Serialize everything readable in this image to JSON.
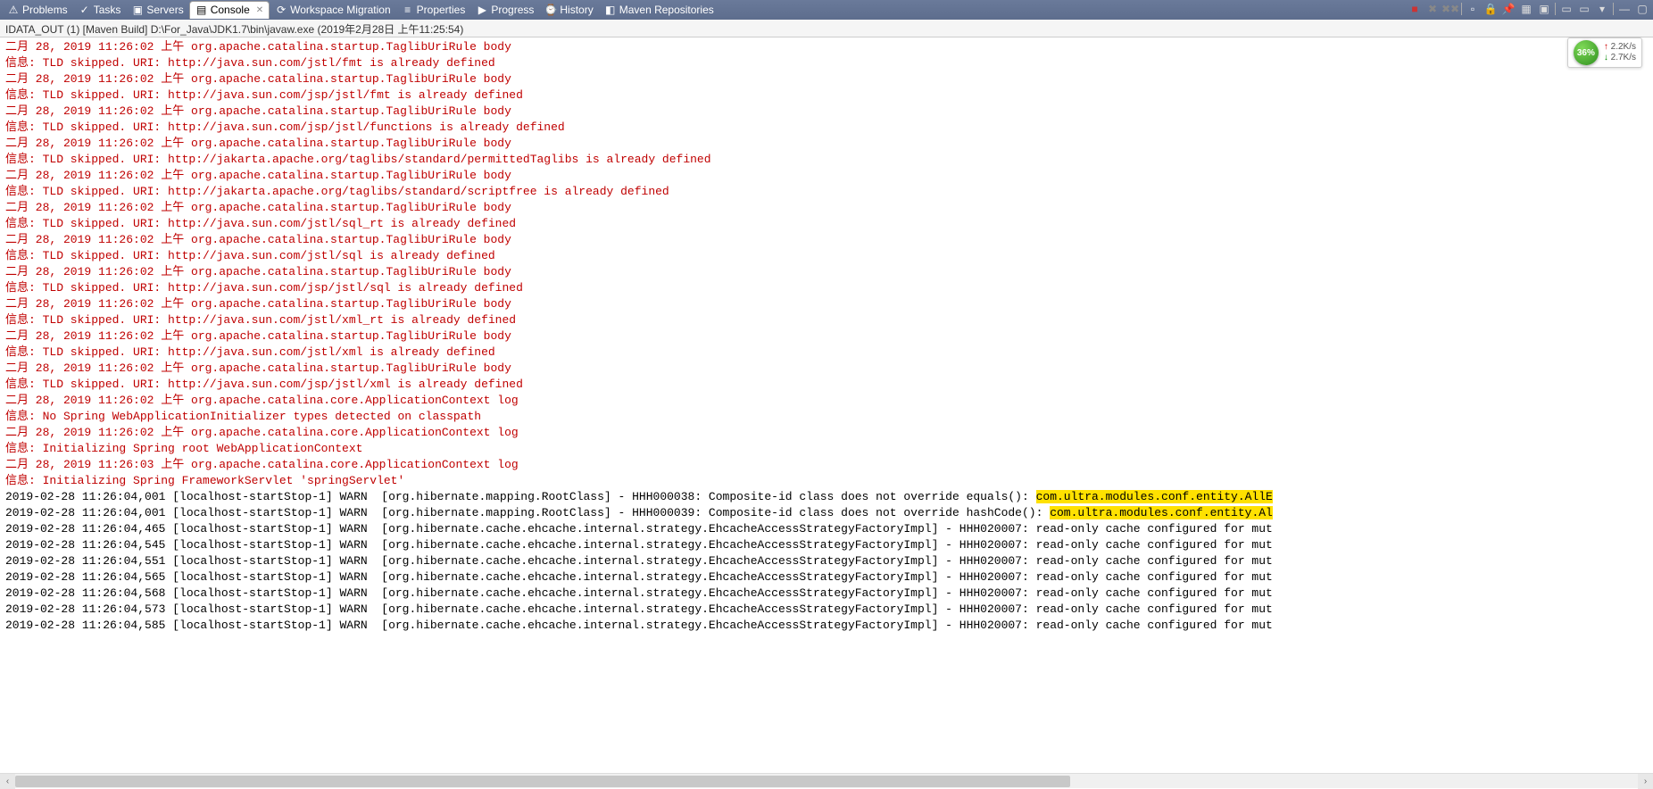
{
  "tabs": [
    {
      "label": "Problems",
      "icon": "⚠"
    },
    {
      "label": "Tasks",
      "icon": "✓"
    },
    {
      "label": "Servers",
      "icon": "▣"
    },
    {
      "label": "Console",
      "icon": "▤",
      "active": true
    },
    {
      "label": "Workspace Migration",
      "icon": "⟳"
    },
    {
      "label": "Properties",
      "icon": "≡"
    },
    {
      "label": "Progress",
      "icon": "▶"
    },
    {
      "label": "History",
      "icon": "⌚"
    },
    {
      "label": "Maven Repositories",
      "icon": "◧"
    }
  ],
  "console_header": "IDATA_OUT (1) [Maven Build] D:\\For_Java\\JDK1.7\\bin\\javaw.exe (2019年2月28日 上午11:25:54)",
  "net": {
    "pct": "36%",
    "up": "2.2K/s",
    "down": "2.7K/s"
  },
  "red_lines": [
    "二月 28, 2019 11:26:02 上午 org.apache.catalina.startup.TaglibUriRule body",
    "信息: TLD skipped. URI: http://java.sun.com/jstl/fmt is already defined",
    "二月 28, 2019 11:26:02 上午 org.apache.catalina.startup.TaglibUriRule body",
    "信息: TLD skipped. URI: http://java.sun.com/jsp/jstl/fmt is already defined",
    "二月 28, 2019 11:26:02 上午 org.apache.catalina.startup.TaglibUriRule body",
    "信息: TLD skipped. URI: http://java.sun.com/jsp/jstl/functions is already defined",
    "二月 28, 2019 11:26:02 上午 org.apache.catalina.startup.TaglibUriRule body",
    "信息: TLD skipped. URI: http://jakarta.apache.org/taglibs/standard/permittedTaglibs is already defined",
    "二月 28, 2019 11:26:02 上午 org.apache.catalina.startup.TaglibUriRule body",
    "信息: TLD skipped. URI: http://jakarta.apache.org/taglibs/standard/scriptfree is already defined",
    "二月 28, 2019 11:26:02 上午 org.apache.catalina.startup.TaglibUriRule body",
    "信息: TLD skipped. URI: http://java.sun.com/jstl/sql_rt is already defined",
    "二月 28, 2019 11:26:02 上午 org.apache.catalina.startup.TaglibUriRule body",
    "信息: TLD skipped. URI: http://java.sun.com/jstl/sql is already defined",
    "二月 28, 2019 11:26:02 上午 org.apache.catalina.startup.TaglibUriRule body",
    "信息: TLD skipped. URI: http://java.sun.com/jsp/jstl/sql is already defined",
    "二月 28, 2019 11:26:02 上午 org.apache.catalina.startup.TaglibUriRule body",
    "信息: TLD skipped. URI: http://java.sun.com/jstl/xml_rt is already defined",
    "二月 28, 2019 11:26:02 上午 org.apache.catalina.startup.TaglibUriRule body",
    "信息: TLD skipped. URI: http://java.sun.com/jstl/xml is already defined",
    "二月 28, 2019 11:26:02 上午 org.apache.catalina.startup.TaglibUriRule body",
    "信息: TLD skipped. URI: http://java.sun.com/jsp/jstl/xml is already defined",
    "二月 28, 2019 11:26:02 上午 org.apache.catalina.core.ApplicationContext log",
    "信息: No Spring WebApplicationInitializer types detected on classpath",
    "二月 28, 2019 11:26:02 上午 org.apache.catalina.core.ApplicationContext log",
    "信息: Initializing Spring root WebApplicationContext",
    "二月 28, 2019 11:26:03 上午 org.apache.catalina.core.ApplicationContext log",
    "信息: Initializing Spring FrameworkServlet 'springServlet'"
  ],
  "black_lines": [
    {
      "pre": "2019-02-28 11:26:04,001 [localhost-startStop-1] WARN  [org.hibernate.mapping.RootClass] - HHH000038: Composite-id class does not override equals(): ",
      "hl": "com.ultra.modules.conf.entity.AllE"
    },
    {
      "pre": "2019-02-28 11:26:04,001 [localhost-startStop-1] WARN  [org.hibernate.mapping.RootClass] - HHH000039: Composite-id class does not override hashCode(): ",
      "hl": "com.ultra.modules.conf.entity.Al"
    },
    {
      "pre": "2019-02-28 11:26:04,465 [localhost-startStop-1] WARN  [org.hibernate.cache.ehcache.internal.strategy.EhcacheAccessStrategyFactoryImpl] - HHH020007: read-only cache configured for mut",
      "hl": ""
    },
    {
      "pre": "2019-02-28 11:26:04,545 [localhost-startStop-1] WARN  [org.hibernate.cache.ehcache.internal.strategy.EhcacheAccessStrategyFactoryImpl] - HHH020007: read-only cache configured for mut",
      "hl": ""
    },
    {
      "pre": "2019-02-28 11:26:04,551 [localhost-startStop-1] WARN  [org.hibernate.cache.ehcache.internal.strategy.EhcacheAccessStrategyFactoryImpl] - HHH020007: read-only cache configured for mut",
      "hl": ""
    },
    {
      "pre": "2019-02-28 11:26:04,565 [localhost-startStop-1] WARN  [org.hibernate.cache.ehcache.internal.strategy.EhcacheAccessStrategyFactoryImpl] - HHH020007: read-only cache configured for mut",
      "hl": ""
    },
    {
      "pre": "2019-02-28 11:26:04,568 [localhost-startStop-1] WARN  [org.hibernate.cache.ehcache.internal.strategy.EhcacheAccessStrategyFactoryImpl] - HHH020007: read-only cache configured for mut",
      "hl": ""
    },
    {
      "pre": "2019-02-28 11:26:04,573 [localhost-startStop-1] WARN  [org.hibernate.cache.ehcache.internal.strategy.EhcacheAccessStrategyFactoryImpl] - HHH020007: read-only cache configured for mut",
      "hl": ""
    },
    {
      "pre": "2019-02-28 11:26:04,585 [localhost-startStop-1] WARN  [org.hibernate.cache.ehcache.internal.strategy.EhcacheAccessStrategyFactoryImpl] - HHH020007: read-only cache configured for mut",
      "hl": ""
    }
  ]
}
